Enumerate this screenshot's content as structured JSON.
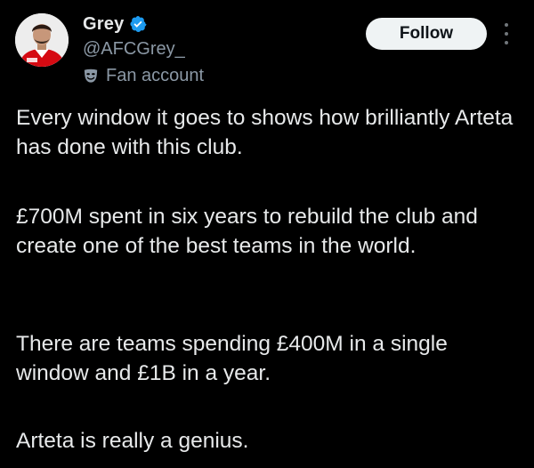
{
  "tweet": {
    "author": {
      "display_name": "Grey",
      "handle": "@AFCGrey_",
      "label": "Fan account",
      "verified_color": "#1d9bf0"
    },
    "actions": {
      "follow_label": "Follow"
    },
    "paragraphs": [
      "Every window it goes to shows how brilliantly Arteta has done with this club.",
      "£700M spent in six years to rebuild the club and create one of the best teams in the world.",
      "There are teams spending £400M in a single window and £1B in a year.",
      "Arteta is really a genius."
    ]
  },
  "theme": {
    "background": "#000000",
    "text": "#e7e9ea",
    "secondary_text": "#8b98a5",
    "button_bg": "#eff3f4"
  },
  "icons": [
    "verified-badge-icon",
    "fan-account-mask-icon",
    "more-options-icon"
  ]
}
